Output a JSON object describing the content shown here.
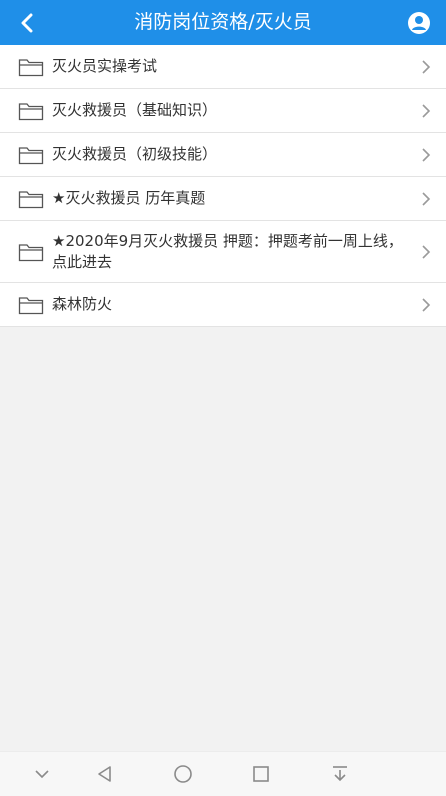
{
  "header": {
    "title": "消防岗位资格/灭火员",
    "back_icon": "chevron-left-icon",
    "user_icon": "user-icon"
  },
  "list": {
    "items": [
      {
        "label": "灭火员实操考试"
      },
      {
        "label": "灭火救援员（基础知识）"
      },
      {
        "label": "灭火救援员（初级技能）"
      },
      {
        "label": "★灭火救援员 历年真题"
      },
      {
        "label": "★2020年9月灭火救援员 押题：押题考前一周上线，点此进去"
      },
      {
        "label": "森林防火"
      }
    ]
  },
  "navbar": {
    "icons": [
      "chevron-down-icon",
      "back-triangle-icon",
      "home-circle-icon",
      "recents-square-icon",
      "download-icon"
    ]
  },
  "colors": {
    "header_bg": "#1f8fe8",
    "background": "#f2f2f2",
    "text": "#333333"
  }
}
